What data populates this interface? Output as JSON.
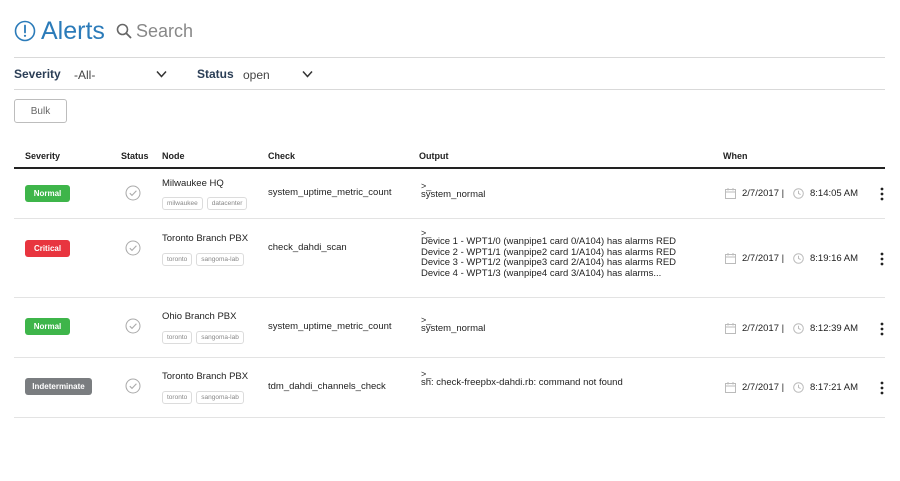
{
  "header": {
    "title": "Alerts",
    "search_placeholder": "Search"
  },
  "filters": {
    "severity": {
      "label": "Severity",
      "value": "-All-"
    },
    "status": {
      "label": "Status",
      "value": "open"
    }
  },
  "bulk_label": "Bulk",
  "columns": [
    "Severity",
    "Status",
    "Node",
    "Check",
    "Output",
    "When"
  ],
  "rows": [
    {
      "severity": "Normal",
      "severity_color": "#3eb54a",
      "node": "Milwaukee HQ",
      "tags": [
        "milwaukee",
        "datacenter"
      ],
      "check": "system_uptime_metric_count",
      "prompt": ">_",
      "output": [
        "system_normal"
      ],
      "date": "2/7/2017 |",
      "time": "8:14:05 AM"
    },
    {
      "severity": "Critical",
      "severity_color": "#e8353f",
      "node": "Toronto Branch PBX",
      "tags": [
        "toronto",
        "sangoma-lab"
      ],
      "check": "check_dahdi_scan",
      "prompt": ">_",
      "output": [
        "Device 1 - WPT1/0 (wanpipe1 card 0/A104) has alarms RED",
        "Device 2 - WPT1/1 (wanpipe2 card 1/A104) has alarms RED",
        "Device 3 - WPT1/2 (wanpipe3 card 2/A104) has alarms RED",
        "Device 4 - WPT1/3 (wanpipe4 card 3/A104) has alarms..."
      ],
      "date": "2/7/2017 |",
      "time": "8:19:16 AM"
    },
    {
      "severity": "Normal",
      "severity_color": "#3eb54a",
      "node": "Ohio Branch PBX",
      "tags": [
        "toronto",
        "sangoma-lab"
      ],
      "check": "system_uptime_metric_count",
      "prompt": ">_",
      "output": [
        "system_normal"
      ],
      "date": "2/7/2017 |",
      "time": "8:12:39 AM"
    },
    {
      "severity": "Indeterminate",
      "severity_color": "#7a7d80",
      "node": "Toronto Branch PBX",
      "tags": [
        "toronto",
        "sangoma-lab"
      ],
      "check": "tdm_dahdi_channels_check",
      "prompt": ">_",
      "output": [
        "sh: check-freepbx-dahdi.rb: command not found"
      ],
      "date": "2/7/2017 |",
      "time": "8:17:21 AM"
    }
  ],
  "colors": {
    "accent": "#2b7bb9",
    "label": "#2b3e56"
  },
  "icons": [
    "alert-circle-icon",
    "search-icon",
    "chevron-down-icon",
    "check-circle-icon",
    "calendar-icon",
    "clock-icon",
    "more-vertical-icon"
  ]
}
